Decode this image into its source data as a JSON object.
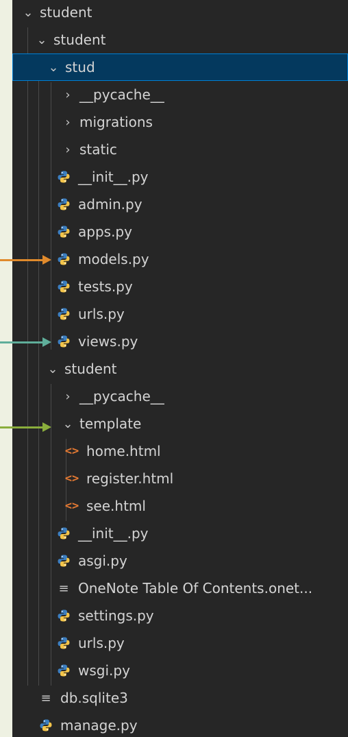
{
  "explorer": {
    "items": [
      {
        "label": "student",
        "kind": "folder-open"
      },
      {
        "label": "student",
        "kind": "folder-open"
      },
      {
        "label": "stud",
        "kind": "folder-open",
        "selected": true
      },
      {
        "label": "__pycache__",
        "kind": "folder-closed"
      },
      {
        "label": "migrations",
        "kind": "folder-closed"
      },
      {
        "label": "static",
        "kind": "folder-closed"
      },
      {
        "label": "__init__.py",
        "kind": "python"
      },
      {
        "label": "admin.py",
        "kind": "python"
      },
      {
        "label": "apps.py",
        "kind": "python"
      },
      {
        "label": "models.py",
        "kind": "python"
      },
      {
        "label": "tests.py",
        "kind": "python"
      },
      {
        "label": "urls.py",
        "kind": "python"
      },
      {
        "label": "views.py",
        "kind": "python"
      },
      {
        "label": "student",
        "kind": "folder-open"
      },
      {
        "label": "__pycache__",
        "kind": "folder-closed"
      },
      {
        "label": "template",
        "kind": "folder-open"
      },
      {
        "label": "home.html",
        "kind": "html"
      },
      {
        "label": "register.html",
        "kind": "html"
      },
      {
        "label": "see.html",
        "kind": "html"
      },
      {
        "label": "__init__.py",
        "kind": "python"
      },
      {
        "label": "asgi.py",
        "kind": "python"
      },
      {
        "label": "OneNote Table Of Contents.onet...",
        "kind": "text"
      },
      {
        "label": "settings.py",
        "kind": "python"
      },
      {
        "label": "urls.py",
        "kind": "python"
      },
      {
        "label": "wsgi.py",
        "kind": "python"
      },
      {
        "label": "db.sqlite3",
        "kind": "text"
      },
      {
        "label": "manage.py",
        "kind": "python"
      }
    ]
  },
  "icons": {
    "folder-open": "chevron-down-icon",
    "folder-closed": "chevron-right-icon",
    "python": "python-icon",
    "html": "html-icon",
    "text": "text-lines-icon"
  },
  "colors": {
    "sidebar_bg": "#262626",
    "page_bg": "#eef1e2",
    "selection_bg": "#04395e",
    "selection_border": "#007fd4",
    "text": "#d4d4d4",
    "python_blue": "#3c7ebf",
    "python_yellow": "#f3c44a",
    "html_orange": "#e37933",
    "arrow_models": "#e08a2c",
    "arrow_views": "#5fae9a",
    "arrow_template": "#8aae3c"
  },
  "annotation_arrows": [
    {
      "target": "models.py",
      "color": "#e08a2c"
    },
    {
      "target": "views.py",
      "color": "#5fae9a"
    },
    {
      "target": "template",
      "color": "#8aae3c"
    }
  ]
}
